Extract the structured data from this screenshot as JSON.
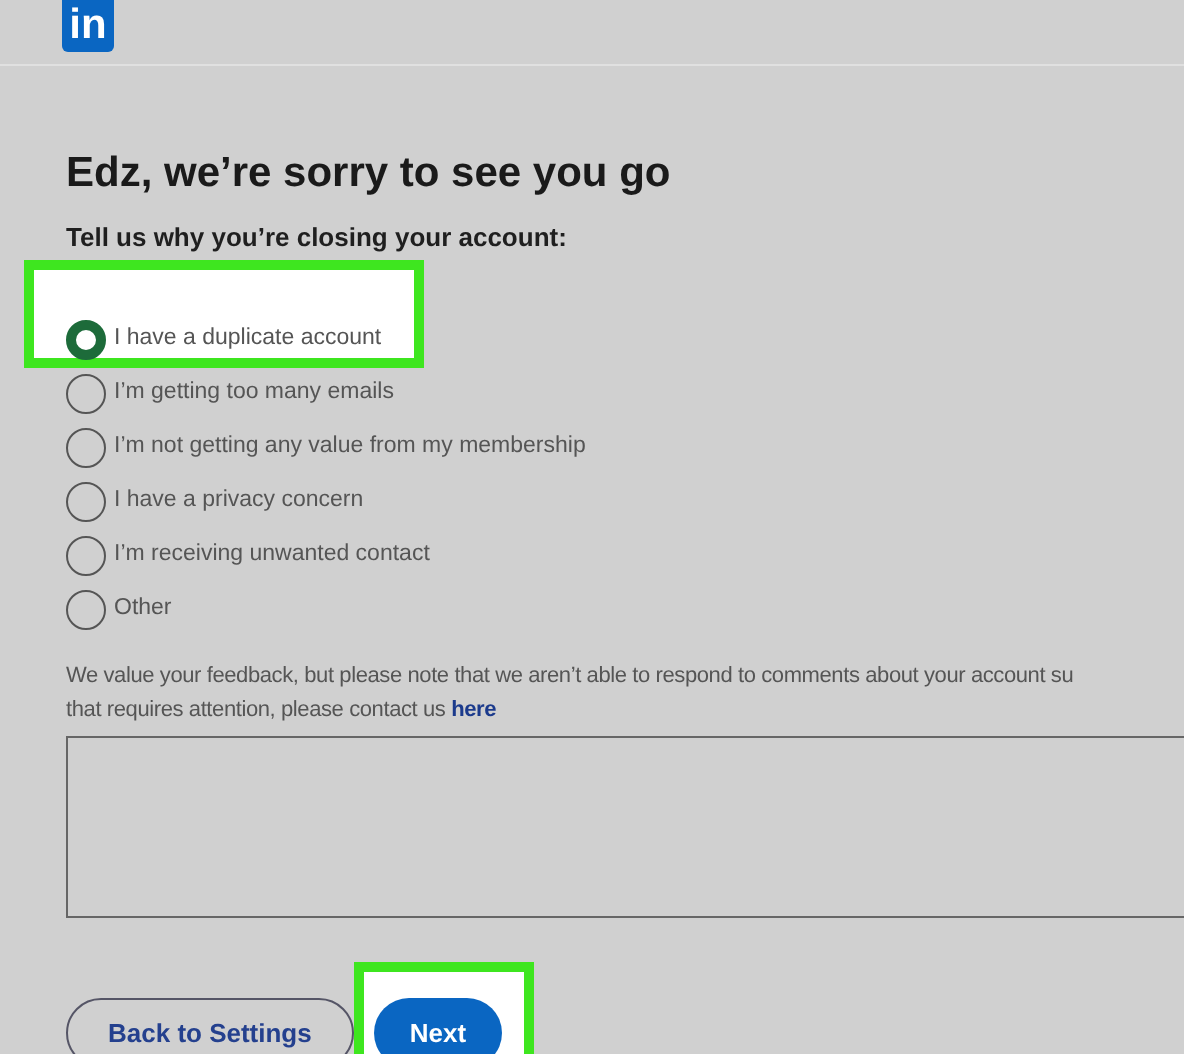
{
  "logo": {
    "text": "in"
  },
  "title": "Edz, we’re sorry to see you go",
  "prompt": "Tell us why you’re closing your account:",
  "reasons": [
    {
      "label": "I have a duplicate account",
      "selected": true,
      "highlighted": true
    },
    {
      "label": "I’m getting too many emails",
      "selected": false,
      "highlighted": false
    },
    {
      "label": "I’m not getting any value from my membership",
      "selected": false,
      "highlighted": false
    },
    {
      "label": "I have a privacy concern",
      "selected": false,
      "highlighted": false
    },
    {
      "label": "I’m receiving unwanted contact",
      "selected": false,
      "highlighted": false
    },
    {
      "label": "Other",
      "selected": false,
      "highlighted": false
    }
  ],
  "feedback_note": {
    "line_1": "We value your feedback, but please note that we aren’t able to respond to comments about your account su",
    "line_2": "that requires attention, please contact us",
    "link": "here"
  },
  "buttons": [
    {
      "label": "Back to Settings",
      "kind": "secondary",
      "highlighted": false
    },
    {
      "label": "Next",
      "kind": "primary",
      "highlighted": true
    }
  ]
}
